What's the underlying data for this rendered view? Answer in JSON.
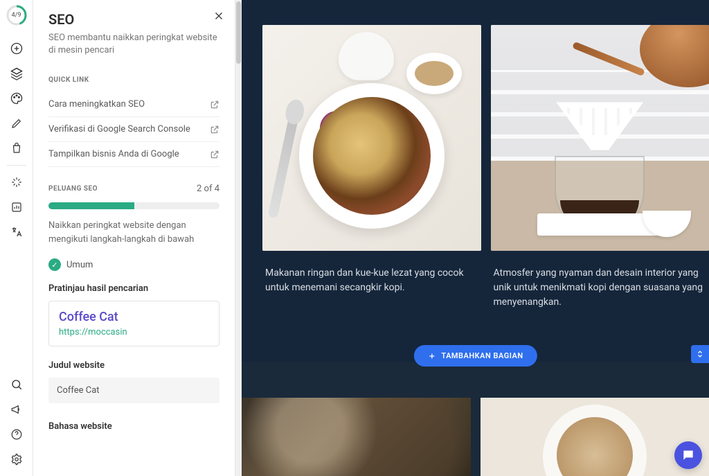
{
  "rail": {
    "progress_label": "4/9"
  },
  "panel": {
    "title": "SEO",
    "subtitle": "SEO membantu naikkan peringkat website di mesin pencari",
    "quick_link_label": "QUICK LINK",
    "links": [
      "Cara meningkatkan SEO",
      "Verifikasi di Google Search Console",
      "Tampilkan bisnis Anda di Google"
    ],
    "opportunity_label": "PELUANG SEO",
    "opportunity_count": "2 of 4",
    "progress_desc": "Naikkan peringkat website dengan mengikuti langkah-langkah di bawah",
    "status_general": "Umum",
    "preview_label": "Pratinjau hasil pencarian",
    "preview_title": "Coffee Cat",
    "preview_url": "https://moccasin",
    "field_title_label": "Judul website",
    "field_title_value": "Coffee Cat",
    "field_lang_label": "Bahasa website"
  },
  "canvas": {
    "card1_caption": "Makanan ringan dan kue-kue lezat yang cocok untuk menemani secangkir kopi.",
    "card2_caption": "Atmosfer yang nyaman dan desain interior yang unik untuk menikmati kopi dengan suasana yang menyenangkan.",
    "add_button": "TAMBAHKAN BAGIAN"
  }
}
